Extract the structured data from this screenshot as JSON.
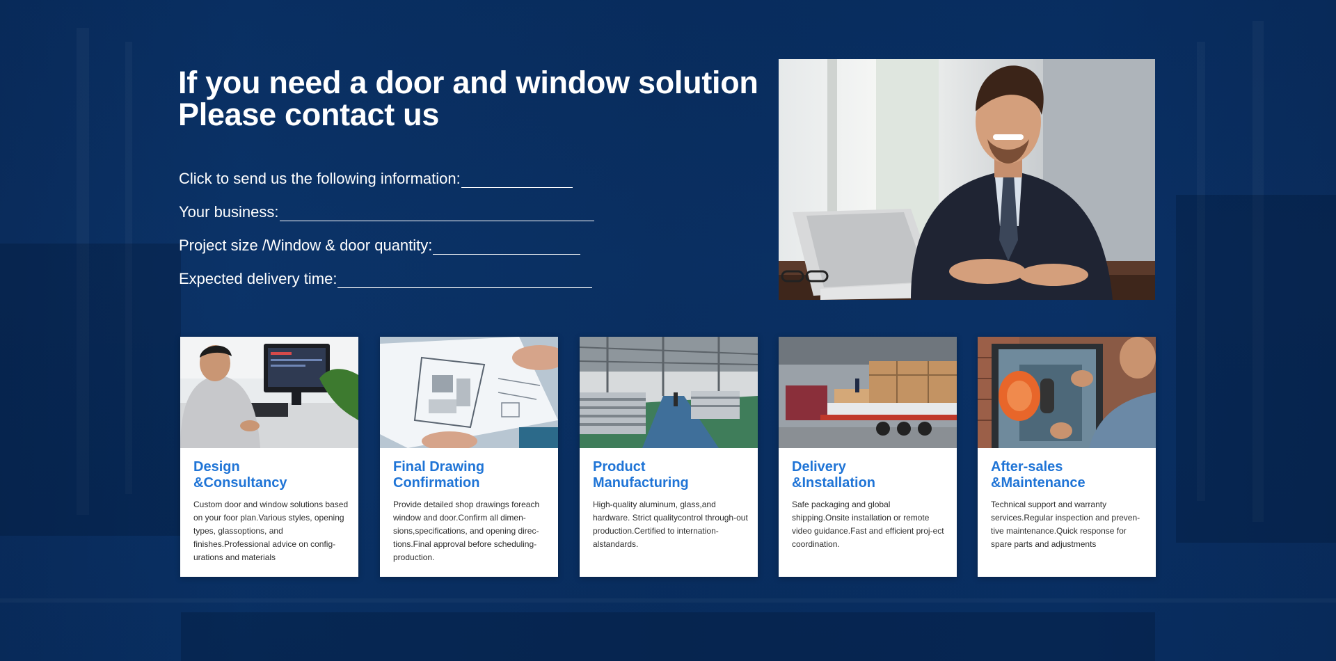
{
  "headline": {
    "line1": "If you need a door and window solution",
    "line2": "Please contact us"
  },
  "form_fields": [
    {
      "label": "Click to send us the following information:"
    },
    {
      "label": "Your business:"
    },
    {
      "label": "Project size /Window & door quantity:"
    },
    {
      "label": "Expected delivery time:"
    }
  ],
  "hero_image": "businessman-with-laptop",
  "cards": [
    {
      "title1": "Design",
      "title2": "&Consultancy",
      "desc": "Custom door and window solutions based on your foor plan.Various styles, opening types, glassoptions, and finishes.Professional advice on config-urations and materials",
      "image": "designer-at-computer"
    },
    {
      "title1": "Final Drawing",
      "title2": "Confirmation",
      "desc": "Provide detailed shop drawings foreach window and door.Confirm all dimen-sions,specifications, and opening direc-tions.Final approval before scheduling-production.",
      "image": "architectural-drawings"
    },
    {
      "title1": "Product",
      "title2": "Manufacturing",
      "desc": "High-quality aluminum, glass,and hardware. Strict qualitycontrol through-out production.Certified to internation-alstandards.",
      "image": "factory-floor"
    },
    {
      "title1": "Delivery",
      "title2": "&Installation",
      "desc": "Safe packaging and global shipping.Onsite installation or remote video guidance.Fast and efficient proj-ect coordination.",
      "image": "truck-loading"
    },
    {
      "title1": "After-sales",
      "title2": "&Maintenance",
      "desc": "Technical support and warranty services.Regular inspection and preven-tive maintenance.Quick response for spare parts and adjustments",
      "image": "glass-installation"
    }
  ],
  "colors": {
    "background": "#0a2f61",
    "accent": "#1f74d6",
    "text_light": "#ffffff"
  }
}
